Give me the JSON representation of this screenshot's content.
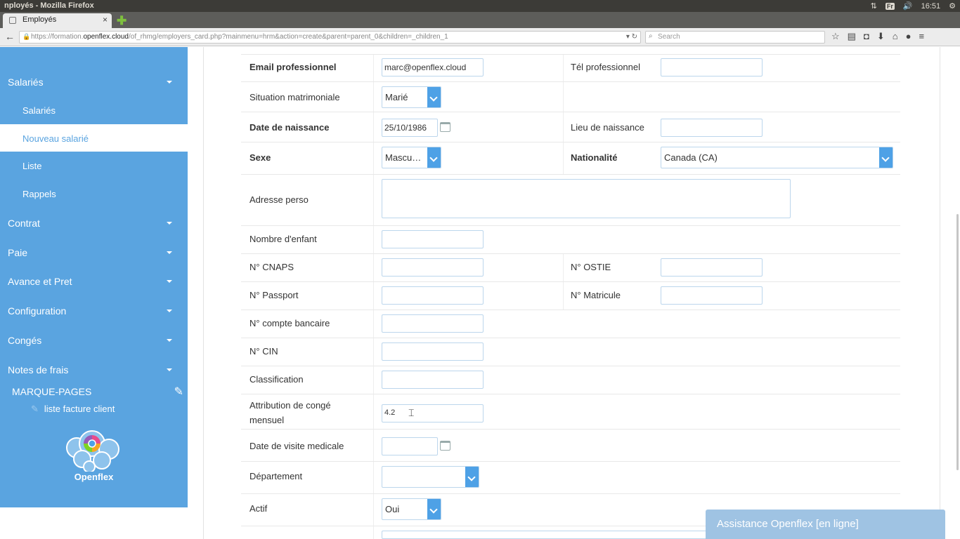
{
  "os": {
    "window_title": "nployés - Mozilla Firefox",
    "keyboard": "Fr",
    "clock": "16:51"
  },
  "browser": {
    "tab_title": "Employés",
    "url_prefix": "https://formation.",
    "url_domain": "openflex.cloud",
    "url_path": "/of_rhmg/employers_card.php?mainmenu=hrm&action=create&parent=parent_0&children=_children_1",
    "search_placeholder": "Search"
  },
  "sidebar": {
    "salaries": "Salariés",
    "sub": [
      "Salariés",
      "Nouveau salarié",
      "Liste",
      "Rappels"
    ],
    "menus": [
      "Contrat",
      "Paie",
      "Avance et Pret",
      "Configuration",
      "Congés",
      "Notes de frais"
    ],
    "bookmarks_title": "MARQUE-PAGES",
    "bookmark_item": "liste facture client",
    "logo_text": "Openflex"
  },
  "form": {
    "email_label": "Email professionnel",
    "email_value": "marc@openflex.cloud",
    "tel_label": "Tél professionnel",
    "situation_label": "Situation matrimoniale",
    "situation_value": "Marié",
    "dob_label": "Date de naissance",
    "dob_value": "25/10/1986",
    "lieu_label": "Lieu de naissance",
    "sexe_label": "Sexe",
    "sexe_value": "Mascu…",
    "nat_label": "Nationalité",
    "nat_value": "Canada (CA)",
    "adresse_label": "Adresse perso",
    "enfant_label": "Nombre d'enfant",
    "cnaps_label": "N° CNAPS",
    "ostie_label": "N° OSTIE",
    "passport_label": "N° Passport",
    "matricule_label": "N° Matricule",
    "compte_label": "N° compte bancaire",
    "cin_label": "N° CIN",
    "classif_label": "Classification",
    "conge_label_1": "Attribution de congé",
    "conge_label_2": "mensuel",
    "conge_value": "4.2",
    "visite_label": "Date de visite medicale",
    "dept_label": "Département",
    "actif_label": "Actif",
    "actif_value": "Oui"
  },
  "chat": "Assistance Openflex [en ligne]"
}
